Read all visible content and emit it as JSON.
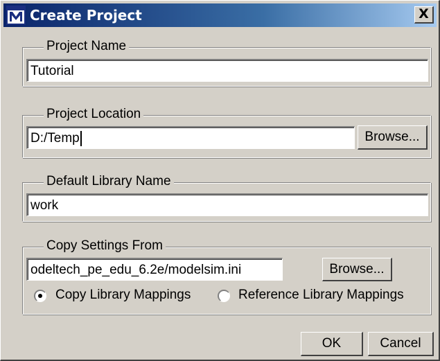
{
  "dialog": {
    "title": "Create Project",
    "close_label": "X"
  },
  "project_name": {
    "legend": "Project Name",
    "value": "Tutorial"
  },
  "project_location": {
    "legend": "Project Location",
    "value": "D:/Temp",
    "browse_label": "Browse..."
  },
  "default_library": {
    "legend": "Default Library Name",
    "value": "work"
  },
  "copy_settings": {
    "legend": "Copy Settings From",
    "value": "odeltech_pe_edu_6.2e/modelsim.ini",
    "browse_label": "Browse...",
    "option_copy": "Copy Library Mappings",
    "option_reference": "Reference Library Mappings",
    "selected": "copy"
  },
  "footer": {
    "ok_label": "OK",
    "cancel_label": "Cancel"
  },
  "colors": {
    "title_bar_start": "#0a246a",
    "title_bar_end": "#a6caf0",
    "face": "#d4d0c8"
  }
}
